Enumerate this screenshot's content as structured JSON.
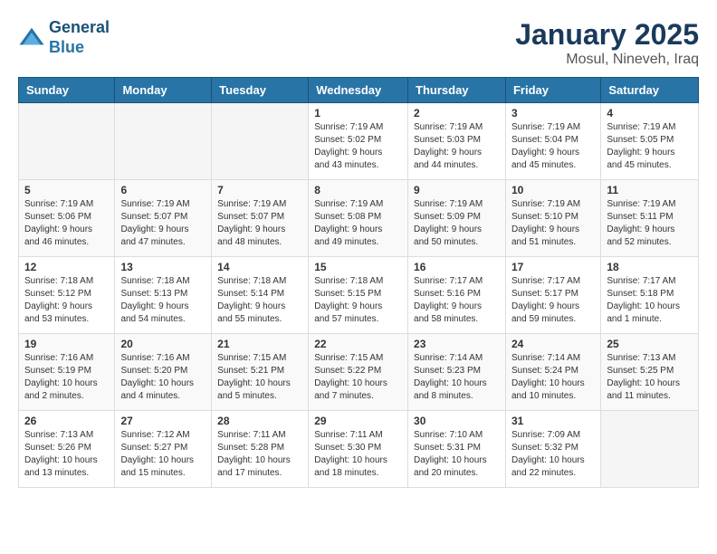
{
  "header": {
    "logo_line1": "General",
    "logo_line2": "Blue",
    "month": "January 2025",
    "location": "Mosul, Nineveh, Iraq"
  },
  "weekdays": [
    "Sunday",
    "Monday",
    "Tuesday",
    "Wednesday",
    "Thursday",
    "Friday",
    "Saturday"
  ],
  "weeks": [
    [
      {
        "day": "",
        "info": ""
      },
      {
        "day": "",
        "info": ""
      },
      {
        "day": "",
        "info": ""
      },
      {
        "day": "1",
        "info": "Sunrise: 7:19 AM\nSunset: 5:02 PM\nDaylight: 9 hours\nand 43 minutes."
      },
      {
        "day": "2",
        "info": "Sunrise: 7:19 AM\nSunset: 5:03 PM\nDaylight: 9 hours\nand 44 minutes."
      },
      {
        "day": "3",
        "info": "Sunrise: 7:19 AM\nSunset: 5:04 PM\nDaylight: 9 hours\nand 45 minutes."
      },
      {
        "day": "4",
        "info": "Sunrise: 7:19 AM\nSunset: 5:05 PM\nDaylight: 9 hours\nand 45 minutes."
      }
    ],
    [
      {
        "day": "5",
        "info": "Sunrise: 7:19 AM\nSunset: 5:06 PM\nDaylight: 9 hours\nand 46 minutes."
      },
      {
        "day": "6",
        "info": "Sunrise: 7:19 AM\nSunset: 5:07 PM\nDaylight: 9 hours\nand 47 minutes."
      },
      {
        "day": "7",
        "info": "Sunrise: 7:19 AM\nSunset: 5:07 PM\nDaylight: 9 hours\nand 48 minutes."
      },
      {
        "day": "8",
        "info": "Sunrise: 7:19 AM\nSunset: 5:08 PM\nDaylight: 9 hours\nand 49 minutes."
      },
      {
        "day": "9",
        "info": "Sunrise: 7:19 AM\nSunset: 5:09 PM\nDaylight: 9 hours\nand 50 minutes."
      },
      {
        "day": "10",
        "info": "Sunrise: 7:19 AM\nSunset: 5:10 PM\nDaylight: 9 hours\nand 51 minutes."
      },
      {
        "day": "11",
        "info": "Sunrise: 7:19 AM\nSunset: 5:11 PM\nDaylight: 9 hours\nand 52 minutes."
      }
    ],
    [
      {
        "day": "12",
        "info": "Sunrise: 7:18 AM\nSunset: 5:12 PM\nDaylight: 9 hours\nand 53 minutes."
      },
      {
        "day": "13",
        "info": "Sunrise: 7:18 AM\nSunset: 5:13 PM\nDaylight: 9 hours\nand 54 minutes."
      },
      {
        "day": "14",
        "info": "Sunrise: 7:18 AM\nSunset: 5:14 PM\nDaylight: 9 hours\nand 55 minutes."
      },
      {
        "day": "15",
        "info": "Sunrise: 7:18 AM\nSunset: 5:15 PM\nDaylight: 9 hours\nand 57 minutes."
      },
      {
        "day": "16",
        "info": "Sunrise: 7:17 AM\nSunset: 5:16 PM\nDaylight: 9 hours\nand 58 minutes."
      },
      {
        "day": "17",
        "info": "Sunrise: 7:17 AM\nSunset: 5:17 PM\nDaylight: 9 hours\nand 59 minutes."
      },
      {
        "day": "18",
        "info": "Sunrise: 7:17 AM\nSunset: 5:18 PM\nDaylight: 10 hours\nand 1 minute."
      }
    ],
    [
      {
        "day": "19",
        "info": "Sunrise: 7:16 AM\nSunset: 5:19 PM\nDaylight: 10 hours\nand 2 minutes."
      },
      {
        "day": "20",
        "info": "Sunrise: 7:16 AM\nSunset: 5:20 PM\nDaylight: 10 hours\nand 4 minutes."
      },
      {
        "day": "21",
        "info": "Sunrise: 7:15 AM\nSunset: 5:21 PM\nDaylight: 10 hours\nand 5 minutes."
      },
      {
        "day": "22",
        "info": "Sunrise: 7:15 AM\nSunset: 5:22 PM\nDaylight: 10 hours\nand 7 minutes."
      },
      {
        "day": "23",
        "info": "Sunrise: 7:14 AM\nSunset: 5:23 PM\nDaylight: 10 hours\nand 8 minutes."
      },
      {
        "day": "24",
        "info": "Sunrise: 7:14 AM\nSunset: 5:24 PM\nDaylight: 10 hours\nand 10 minutes."
      },
      {
        "day": "25",
        "info": "Sunrise: 7:13 AM\nSunset: 5:25 PM\nDaylight: 10 hours\nand 11 minutes."
      }
    ],
    [
      {
        "day": "26",
        "info": "Sunrise: 7:13 AM\nSunset: 5:26 PM\nDaylight: 10 hours\nand 13 minutes."
      },
      {
        "day": "27",
        "info": "Sunrise: 7:12 AM\nSunset: 5:27 PM\nDaylight: 10 hours\nand 15 minutes."
      },
      {
        "day": "28",
        "info": "Sunrise: 7:11 AM\nSunset: 5:28 PM\nDaylight: 10 hours\nand 17 minutes."
      },
      {
        "day": "29",
        "info": "Sunrise: 7:11 AM\nSunset: 5:30 PM\nDaylight: 10 hours\nand 18 minutes."
      },
      {
        "day": "30",
        "info": "Sunrise: 7:10 AM\nSunset: 5:31 PM\nDaylight: 10 hours\nand 20 minutes."
      },
      {
        "day": "31",
        "info": "Sunrise: 7:09 AM\nSunset: 5:32 PM\nDaylight: 10 hours\nand 22 minutes."
      },
      {
        "day": "",
        "info": ""
      }
    ]
  ]
}
